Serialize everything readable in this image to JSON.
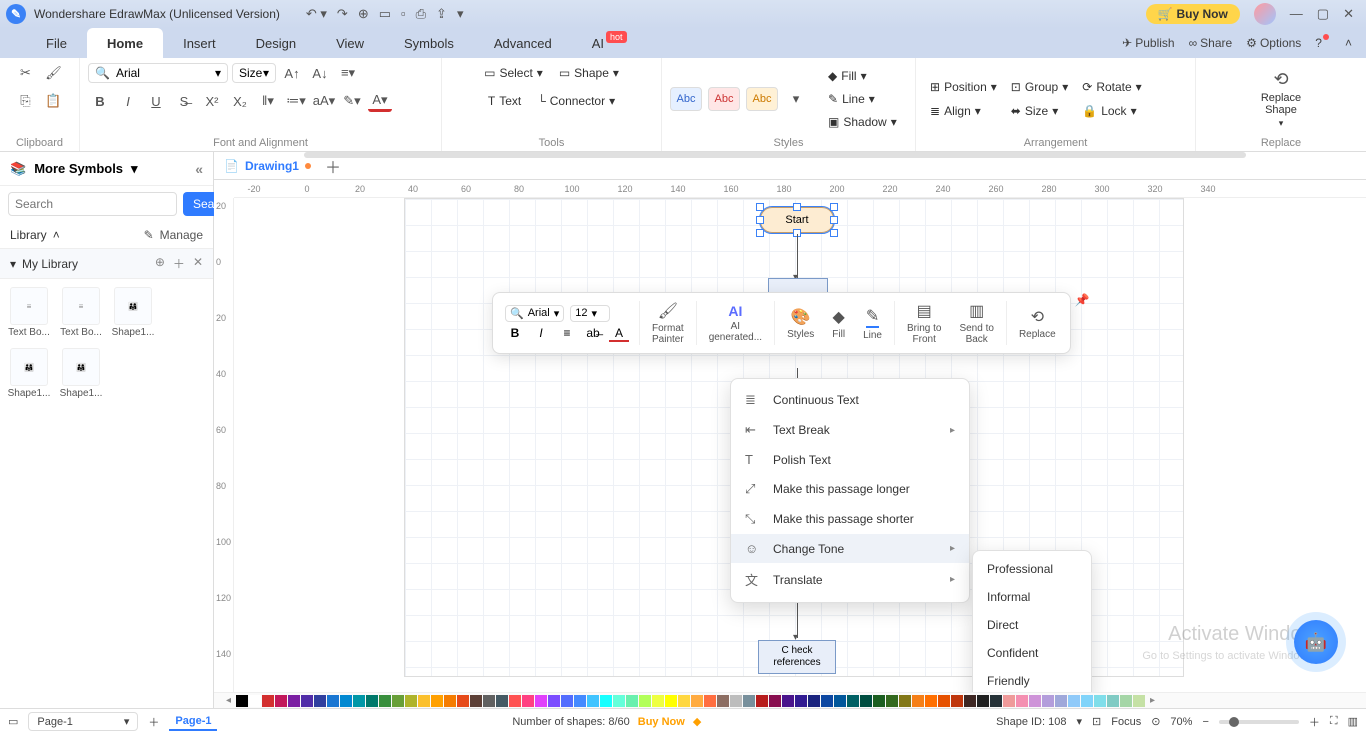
{
  "title": "Wondershare EdrawMax (Unlicensed Version)",
  "buy_now": "Buy Now",
  "menubar": [
    "File",
    "Home",
    "Insert",
    "Design",
    "View",
    "Symbols",
    "Advanced",
    "AI"
  ],
  "menubar_active": 1,
  "right_menu": {
    "publish": "Publish",
    "share": "Share",
    "options": "Options"
  },
  "ribbon": {
    "clipboard": {
      "label": "Clipboard"
    },
    "font_align": {
      "label": "Font and Alignment",
      "font": "Arial",
      "size": "Size",
      "select_btn": "Select",
      "shape_btn": "Shape",
      "text_btn": "Text",
      "connector_btn": "Connector",
      "tools_label": "Tools",
      "styles_label": "Styles",
      "fill": "Fill",
      "line": "Line",
      "shadow": "Shadow",
      "arrangement": "Arrangement",
      "position": "Position",
      "align": "Align",
      "group": "Group",
      "rotate": "Rotate",
      "lock": "Lock",
      "replace": "Replace",
      "replace_shape": "Replace\nShape",
      "swatch": "Abc"
    }
  },
  "leftpanel": {
    "header": "More Symbols",
    "search_placeholder": "Search",
    "search_btn": "Search",
    "library": "Library",
    "manage": "Manage",
    "my_library": "My Library",
    "items": [
      {
        "name": "Text Bo..."
      },
      {
        "name": "Text Bo..."
      },
      {
        "name": "Shape1..."
      },
      {
        "name": "Shape1..."
      },
      {
        "name": "Shape1..."
      }
    ]
  },
  "doc_tab": "Drawing1",
  "shapes": {
    "start": "Start",
    "check_refs": "C heck\nreferences",
    "hidden": "..."
  },
  "mini": {
    "font": "Arial",
    "size": "12",
    "format_painter": "Format\nPainter",
    "ai": "AI\ngenerated...",
    "styles": "Styles",
    "fill": "Fill",
    "line_btn": "Line",
    "bring_front": "Bring to\nFront",
    "send_back": "Send to\nBack",
    "replace": "Replace"
  },
  "context_menu": [
    {
      "icon": "≣",
      "label": "Continuous Text"
    },
    {
      "icon": "⇤",
      "label": "Text Break",
      "arrow": true
    },
    {
      "icon": "T",
      "label": "Polish Text"
    },
    {
      "icon": "⤢",
      "label": "Make this passage longer"
    },
    {
      "icon": "⤡",
      "label": "Make this passage shorter"
    },
    {
      "icon": "☺",
      "label": "Change Tone",
      "arrow": true,
      "highlight": true
    },
    {
      "icon": "文",
      "label": "Translate",
      "arrow": true
    }
  ],
  "submenu": [
    "Professional",
    "Informal",
    "Direct",
    "Confident",
    "Friendly"
  ],
  "ruler_h": [
    -20,
    0,
    20,
    40,
    60,
    80,
    100,
    120,
    140,
    160,
    180,
    200,
    220,
    240,
    260,
    280,
    300,
    320,
    340
  ],
  "ruler_v": [
    20,
    0,
    20,
    40,
    60,
    80,
    100,
    120,
    140
  ],
  "statusbar": {
    "page": "Page-1",
    "page_tab": "Page-1",
    "num_shapes": "Number of shapes: 8/60",
    "buy_now": "Buy Now",
    "shape_id": "Shape ID: 108",
    "focus": "Focus",
    "zoom": "70%"
  },
  "watermark": "Activate Windows",
  "sub_watermark": "Go to Settings to activate Windows.",
  "colors": [
    "#000",
    "#fff",
    "#d32f2f",
    "#c2185b",
    "#7b1fa2",
    "#512da8",
    "#303f9f",
    "#1976d2",
    "#0288d1",
    "#0097a7",
    "#00796b",
    "#388e3c",
    "#689f38",
    "#afb42b",
    "#fbc02d",
    "#ffa000",
    "#f57c00",
    "#e64a19",
    "#5d4037",
    "#616161",
    "#455a64",
    "#ff5252",
    "#ff4081",
    "#e040fb",
    "#7c4dff",
    "#536dfe",
    "#448aff",
    "#40c4ff",
    "#18ffff",
    "#64ffda",
    "#69f0ae",
    "#b2ff59",
    "#eeff41",
    "#ffff00",
    "#ffd740",
    "#ffab40",
    "#ff6e40",
    "#8d6e63",
    "#bdbdbd",
    "#78909c",
    "#b71c1c",
    "#880e4f",
    "#4a148c",
    "#311b92",
    "#1a237e",
    "#0d47a1",
    "#01579b",
    "#006064",
    "#004d40",
    "#1b5e20",
    "#33691e",
    "#827717",
    "#f57f17",
    "#ff6f00",
    "#e65100",
    "#bf360c",
    "#3e2723",
    "#212121",
    "#263238",
    "#ef9a9a",
    "#f48fb1",
    "#ce93d8",
    "#b39ddb",
    "#9fa8da",
    "#90caf9",
    "#81d4fa",
    "#80deea",
    "#80cbc4",
    "#a5d6a7",
    "#c5e1a5"
  ]
}
